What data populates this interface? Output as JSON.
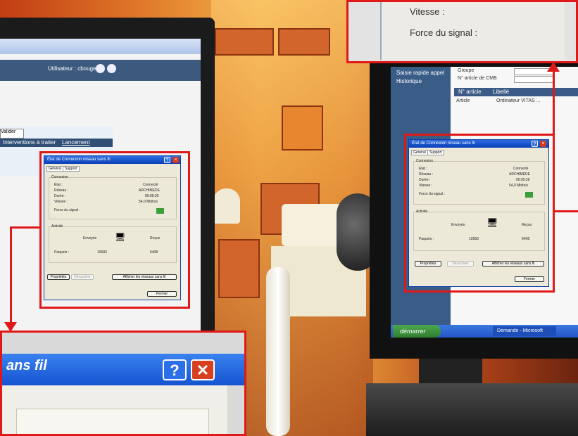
{
  "left_screen": {
    "user_label": "Utilisateur : cbouget",
    "row_label": "Interventions à traiter",
    "row_value": "Lancement",
    "button_label": "Valider"
  },
  "right_screen": {
    "sidebar_items": [
      "Saisie rapide appel",
      "Historique"
    ],
    "field_1": "Groupe",
    "field_2": "N° article de CMB",
    "table_headers": [
      "N° article",
      "Libellé"
    ],
    "table_row": [
      "Article",
      "Ordinateur VITAS ..."
    ],
    "taskbar_start": "démarrer",
    "taskbar_item": "Demande - Microsoft"
  },
  "dialog": {
    "title": "État de Connexion réseau sans fil",
    "tabs": [
      "Général",
      "Support"
    ],
    "group_connection": "Connexion",
    "labels": [
      "État :",
      "Réseau :",
      "Durée :",
      "Vitesse :",
      "Force du signal :"
    ],
    "values": [
      "Connecté",
      "ARCHIMEDE",
      "00:05:26",
      "54,0 Mbits/s"
    ],
    "group_activity": "Activité",
    "sent_label": "Envoyés",
    "received_label": "Reçus",
    "packets_label": "Paquets :",
    "packets_sent": "10583",
    "packets_received": "6408",
    "btn_properties": "Propriétés",
    "btn_disable": "Désactiver",
    "btn_networks": "Afficher les réseaux sans fil",
    "btn_close": "Fermer"
  },
  "zoom_top": {
    "row_speed": "Vitesse :",
    "row_signal": "Force du signal :"
  },
  "zoom_bottom": {
    "title": "ans fil",
    "help_glyph": "?",
    "close_glyph": "✕"
  }
}
